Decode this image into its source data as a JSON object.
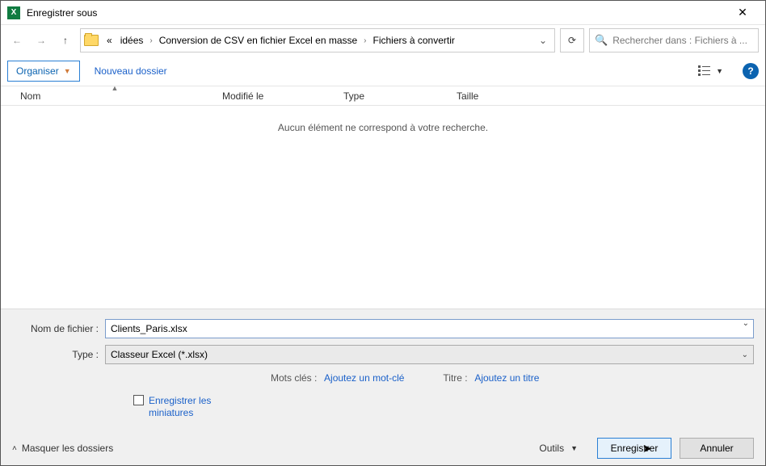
{
  "window": {
    "title": "Enregistrer sous"
  },
  "nav": {
    "crumb_prefix": "«",
    "crumbs": [
      "idées",
      "Conversion de CSV en fichier Excel en masse",
      "Fichiers à convertir"
    ]
  },
  "search": {
    "placeholder": "Rechercher dans : Fichiers à ..."
  },
  "toolbar": {
    "organize_label": "Organiser",
    "new_folder_label": "Nouveau dossier"
  },
  "columns": {
    "name": "Nom",
    "modified": "Modifié le",
    "type": "Type",
    "size": "Taille"
  },
  "empty_message": "Aucun élément ne correspond à votre recherche.",
  "form": {
    "filename_label": "Nom de fichier :",
    "filename_value": "Clients_Paris.xlsx",
    "type_label": "Type :",
    "type_value": "Classeur Excel (*.xlsx)"
  },
  "meta": {
    "keywords_label": "Mots clés :",
    "keywords_link": "Ajoutez un mot-clé",
    "title_label": "Titre :",
    "title_link": "Ajoutez un titre"
  },
  "thumbnails_label": "Enregistrer les miniatures",
  "footer": {
    "hide_folders": "Masquer les dossiers",
    "tools": "Outils",
    "save": "Enregistrer",
    "cancel": "Annuler"
  }
}
